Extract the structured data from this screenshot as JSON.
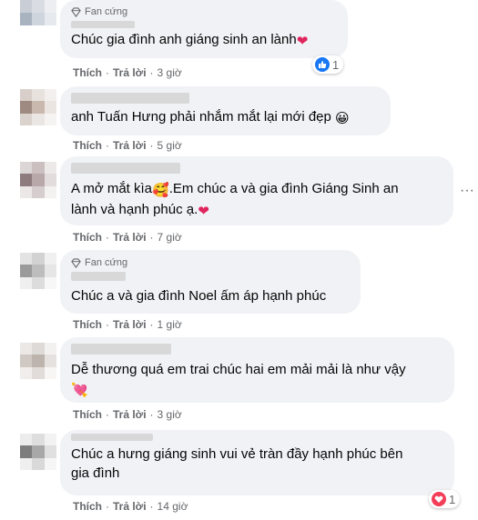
{
  "comments": [
    {
      "badge": "Fan cứng",
      "text": "Chúc gia đình anh giáng sinh an lành",
      "emoji": "❤",
      "like": "Thích",
      "reply": "Trả lời",
      "time": "3 giờ",
      "reaction_count": "1",
      "reaction_icon": "like-icon"
    },
    {
      "text": "anh Tuấn Hưng phải nhắm mắt lại mới đẹp",
      "emoji": "😀",
      "like": "Thích",
      "reply": "Trả lời",
      "time": "5 giờ"
    },
    {
      "text_line1": "A mở mắt kìa",
      "emoji1": "🥰",
      "text_line1b": ".Em chúc a và gia đình Giáng Sinh an",
      "text_line2": "lành và hạnh phúc ạ.",
      "emoji2": "❤",
      "like": "Thích",
      "reply": "Trả lời",
      "time": "7 giờ"
    },
    {
      "badge": "Fan cứng",
      "text": "Chúc a và gia đình Noel ấm áp hạnh phúc",
      "like": "Thích",
      "reply": "Trả lời",
      "time": "1 giờ"
    },
    {
      "text": "Dễ thương quá em trai chúc hai em mải mải là như vậy",
      "emoji": "💘",
      "like": "Thích",
      "reply": "Trả lời",
      "time": "3 giờ"
    },
    {
      "text_line1": "Chúc a hưng giáng sinh vui vẻ tràn đầy hạnh phúc bên",
      "text_line2": "gia đình",
      "like": "Thích",
      "reply": "Trả lời",
      "time": "14 giờ",
      "reaction_count": "1",
      "reaction_icon": "love-icon"
    }
  ],
  "colors": {
    "bubble": "#f0f2f5",
    "meta": "#65676b",
    "like_blue": "#1877f2",
    "love_red": "#f33e58"
  }
}
